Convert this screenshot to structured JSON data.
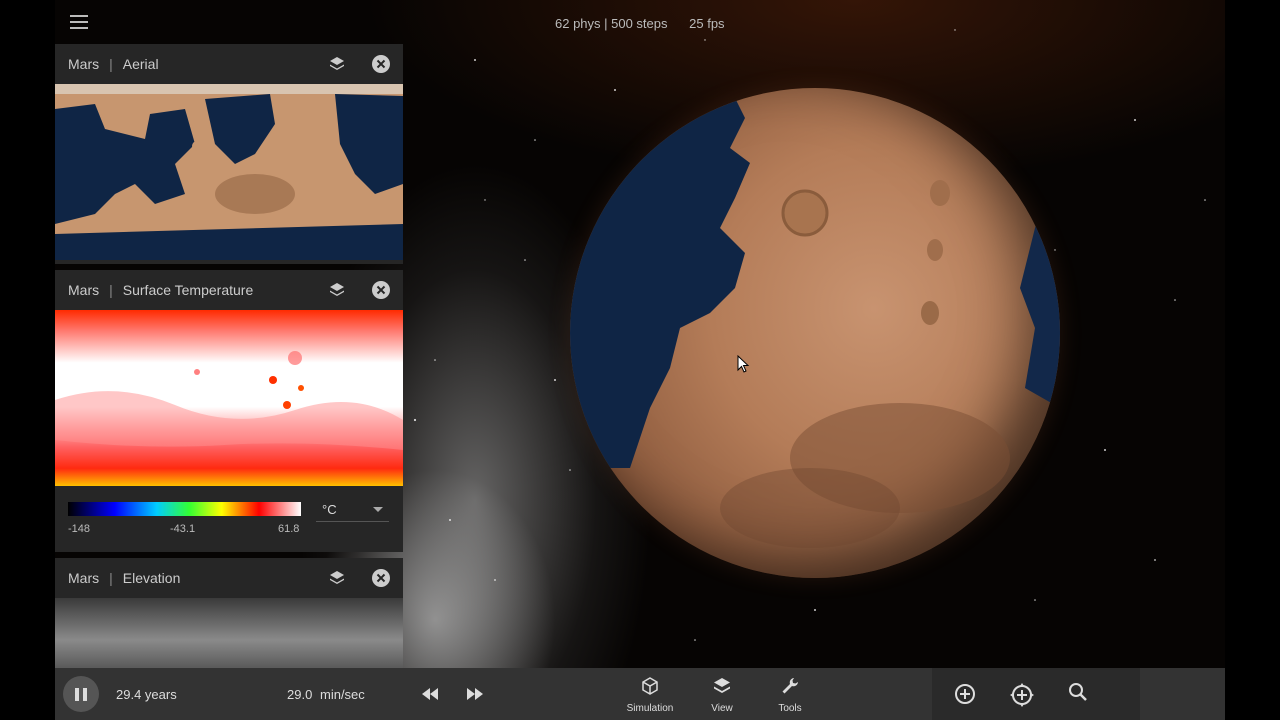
{
  "stats": {
    "physics": "62 phys | 500 steps",
    "fps": "25 fps"
  },
  "panels": {
    "aerial": {
      "planet": "Mars",
      "map": "Aerial"
    },
    "temperature": {
      "planet": "Mars",
      "map": "Surface Temperature",
      "legend": {
        "min": "-148",
        "mid": "-43.1",
        "max": "61.8",
        "unit": "°C"
      }
    },
    "elevation": {
      "planet": "Mars",
      "map": "Elevation"
    }
  },
  "toolbar": {
    "time_elapsed": "29.4 years",
    "rate_value": "29.0",
    "rate_unit": "min/sec",
    "simulation_label": "Simulation",
    "view_label": "View",
    "tools_label": "Tools"
  },
  "icons": [
    "menu-icon",
    "layers-icon",
    "close-icon",
    "pause-icon",
    "rewind-icon",
    "fast-forward-icon",
    "cube-icon",
    "wrench-icon",
    "zoom-in-icon",
    "recenter-icon",
    "search-icon"
  ],
  "colors": {
    "panel_bg": "#262626",
    "toolbar_bg": "#333333",
    "mars": "#b47c58",
    "ocean": "#0f2545"
  }
}
